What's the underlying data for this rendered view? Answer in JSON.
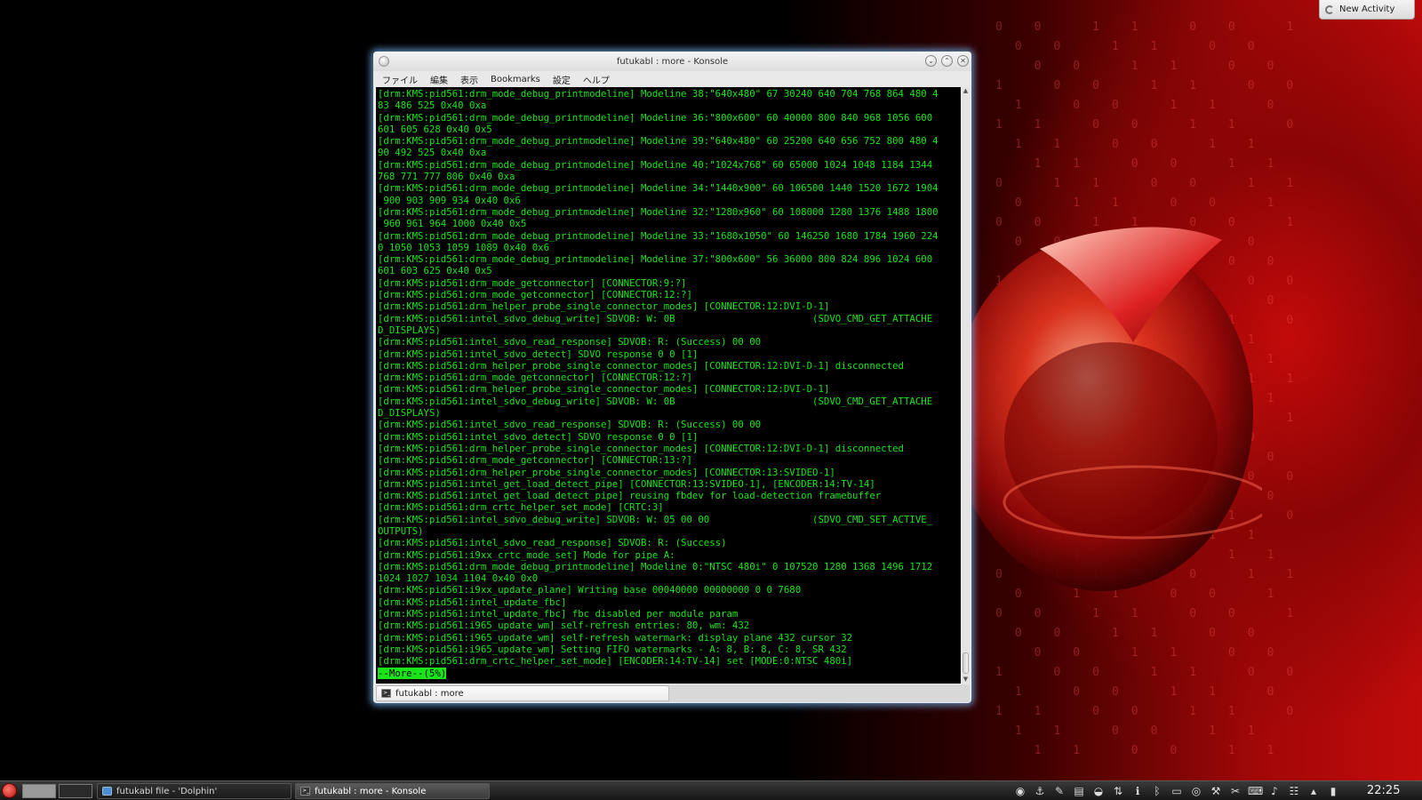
{
  "notifier": {
    "label": "New Activity"
  },
  "window": {
    "title": "futukabl : more - Konsole",
    "minimize_glyph": "⌄",
    "maximize_glyph": "⌃",
    "close_glyph": "✕"
  },
  "menubar": {
    "items": [
      "ファイル",
      "編集",
      "表示",
      "Bookmarks",
      "設定",
      "ヘルプ"
    ]
  },
  "terminal": {
    "lines": [
      "[drm:KMS:pid561:drm_mode_debug_printmodeline] Modeline 38:\"640x480\" 67 30240 640 704 768 864 480 4",
      "83 486 525 0x40 0xa",
      "[drm:KMS:pid561:drm_mode_debug_printmodeline] Modeline 36:\"800x600\" 60 40000 800 840 968 1056 600",
      "601 605 628 0x40 0x5",
      "[drm:KMS:pid561:drm_mode_debug_printmodeline] Modeline 39:\"640x480\" 60 25200 640 656 752 800 480 4",
      "90 492 525 0x40 0xa",
      "[drm:KMS:pid561:drm_mode_debug_printmodeline] Modeline 40:\"1024x768\" 60 65000 1024 1048 1184 1344",
      "768 771 777 806 0x40 0xa",
      "[drm:KMS:pid561:drm_mode_debug_printmodeline] Modeline 34:\"1440x900\" 60 106500 1440 1520 1672 1904",
      " 900 903 909 934 0x40 0x6",
      "[drm:KMS:pid561:drm_mode_debug_printmodeline] Modeline 32:\"1280x960\" 60 108000 1280 1376 1488 1800",
      " 960 961 964 1000 0x40 0x5",
      "[drm:KMS:pid561:drm_mode_debug_printmodeline] Modeline 33:\"1680x1050\" 60 146250 1680 1784 1960 224",
      "0 1050 1053 1059 1089 0x40 0x6",
      "[drm:KMS:pid561:drm_mode_debug_printmodeline] Modeline 37:\"800x600\" 56 36000 800 824 896 1024 600",
      "601 603 625 0x40 0x5",
      "[drm:KMS:pid561:drm_mode_getconnector] [CONNECTOR:9:?]",
      "[drm:KMS:pid561:drm_mode_getconnector] [CONNECTOR:12:?]",
      "[drm:KMS:pid561:drm_helper_probe_single_connector_modes] [CONNECTOR:12:DVI-D-1]",
      "[drm:KMS:pid561:intel_sdvo_debug_write] SDVOB: W: 0B                        (SDVO_CMD_GET_ATTACHE",
      "D_DISPLAYS)",
      "[drm:KMS:pid561:intel_sdvo_read_response] SDVOB: R: (Success) 00 00",
      "[drm:KMS:pid561:intel_sdvo_detect] SDVO response 0 0 [1]",
      "[drm:KMS:pid561:drm_helper_probe_single_connector_modes] [CONNECTOR:12:DVI-D-1] disconnected",
      "[drm:KMS:pid561:drm_mode_getconnector] [CONNECTOR:12:?]",
      "[drm:KMS:pid561:drm_helper_probe_single_connector_modes] [CONNECTOR:12:DVI-D-1]",
      "[drm:KMS:pid561:intel_sdvo_debug_write] SDVOB: W: 0B                        (SDVO_CMD_GET_ATTACHE",
      "D_DISPLAYS)",
      "[drm:KMS:pid561:intel_sdvo_read_response] SDVOB: R: (Success) 00 00",
      "[drm:KMS:pid561:intel_sdvo_detect] SDVO response 0 0 [1]",
      "[drm:KMS:pid561:drm_helper_probe_single_connector_modes] [CONNECTOR:12:DVI-D-1] disconnected",
      "[drm:KMS:pid561:drm_mode_getconnector] [CONNECTOR:13:?]",
      "[drm:KMS:pid561:drm_helper_probe_single_connector_modes] [CONNECTOR:13:SVIDEO-1]",
      "[drm:KMS:pid561:intel_get_load_detect_pipe] [CONNECTOR:13:SVIDEO-1], [ENCODER:14:TV-14]",
      "[drm:KMS:pid561:intel_get_load_detect_pipe] reusing fbdev for load-detection framebuffer",
      "[drm:KMS:pid561:drm_crtc_helper_set_mode] [CRTC:3]",
      "[drm:KMS:pid561:intel_sdvo_debug_write] SDVOB: W: 05 00 00                  (SDVO_CMD_SET_ACTIVE_",
      "OUTPUTS)",
      "[drm:KMS:pid561:intel_sdvo_read_response] SDVOB: R: (Success)",
      "[drm:KMS:pid561:i9xx_crtc_mode_set] Mode for pipe A:",
      "[drm:KMS:pid561:drm_mode_debug_printmodeline] Modeline 0:\"NTSC 480i\" 0 107520 1280 1368 1496 1712",
      "1024 1027 1034 1104 0x40 0x0",
      "[drm:KMS:pid561:i9xx_update_plane] Writing base 00040000 00000000 0 0 7680",
      "[drm:KMS:pid561:intel_update_fbc]",
      "[drm:KMS:pid561:intel_update_fbc] fbc disabled per module param",
      "[drm:KMS:pid561:i965_update_wm] self-refresh entries: 80, wm: 432",
      "[drm:KMS:pid561:i965_update_wm] self-refresh watermark: display plane 432 cursor 32",
      "[drm:KMS:pid561:i965_update_wm] Setting FIFO watermarks - A: 8, B: 8, C: 8, SR 432",
      "[drm:KMS:pid561:drm_crtc_helper_set_mode] [ENCODER:14:TV-14] set [MODE:0:NTSC 480i]"
    ],
    "more_prompt": "--More--(5%)",
    "text_color": "#19e519",
    "background_color": "#000000"
  },
  "tabs": [
    {
      "label": "futukabl : more"
    }
  ],
  "taskbar": {
    "tasks": [
      {
        "label": "futukabl file - 'Dolphin'",
        "icon": "folder-icon"
      },
      {
        "label": "futukabl : more - Konsole",
        "icon": "terminal-icon"
      }
    ],
    "tray_icons": [
      "update-icon",
      "network-icon",
      "notes-icon",
      "clipboard-icon",
      "drive-icon",
      "usb-icon",
      "info-icon",
      "bluetooth-icon",
      "printer-icon",
      "lifebuoy-icon",
      "tool-icon",
      "scissors-icon",
      "keyboard-icon",
      "volume-icon",
      "wifi-icon",
      "expand-arrow-icon",
      "battery-icon"
    ],
    "clock": "22:25"
  }
}
